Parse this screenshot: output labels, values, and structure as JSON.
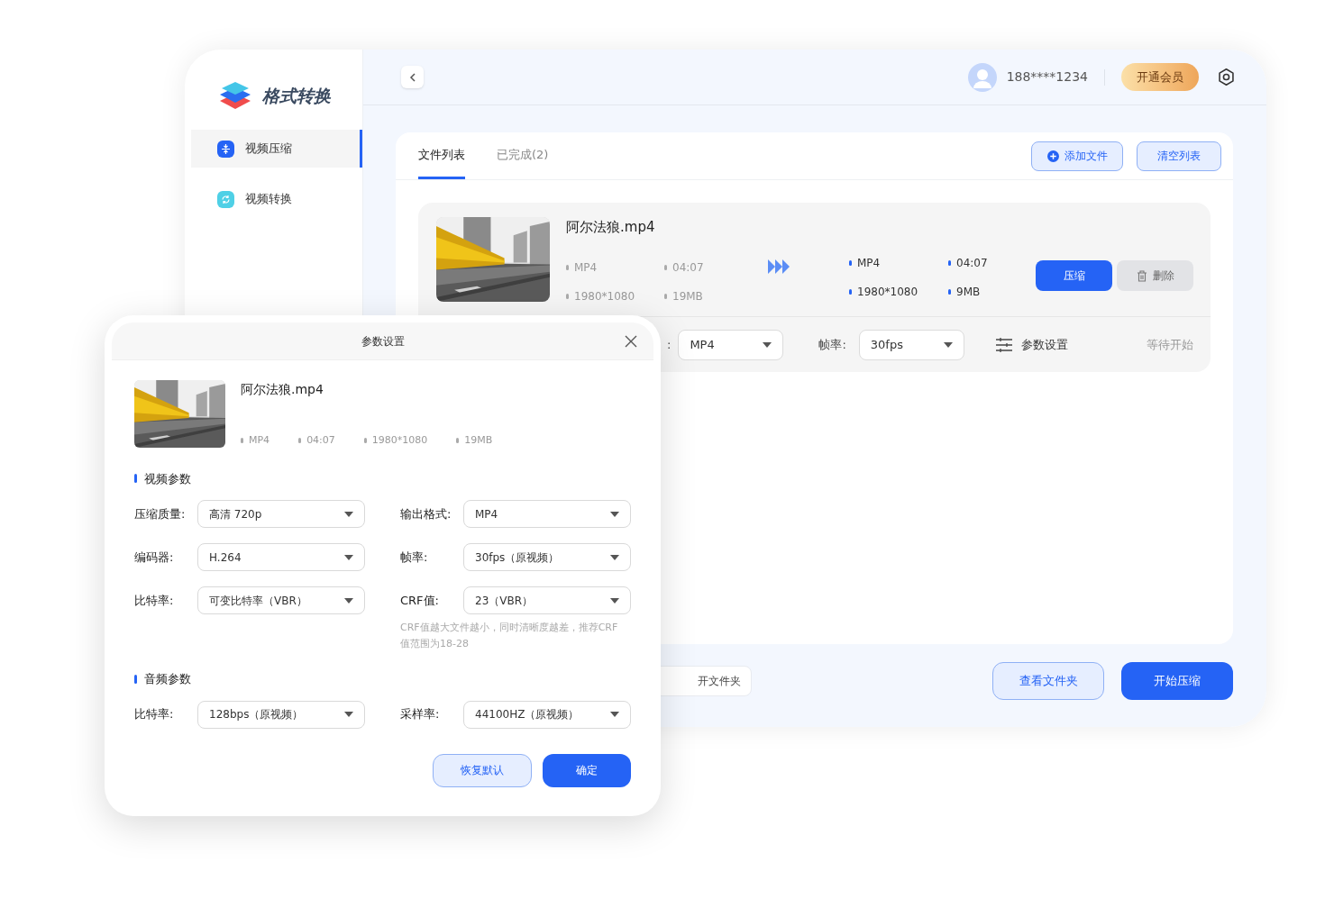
{
  "app": {
    "logo_text": "格式转换"
  },
  "sidebar": {
    "items": [
      {
        "label": "视频压缩",
        "selected": true,
        "kind": "compress"
      },
      {
        "label": "视频转换",
        "selected": false,
        "kind": "convert"
      }
    ]
  },
  "header": {
    "user": "188****1234",
    "vip_button": "开通会员"
  },
  "tabs": [
    {
      "label": "文件列表",
      "selected": true
    },
    {
      "label": "已完成(2)",
      "selected": false
    }
  ],
  "toolbar": {
    "add": "添加文件",
    "clear": "清空列表"
  },
  "file": {
    "name": "阿尔法狼.mp4",
    "source": [
      "MP4",
      "04:07",
      "1980*1080",
      "19MB"
    ],
    "output": [
      "MP4",
      "04:07",
      "1980*1080",
      "9MB"
    ],
    "compress_button": "压缩",
    "delete_button": "删除",
    "settings": [
      {
        "label": ":",
        "value": "MP4"
      },
      {
        "label": "帧率:",
        "value": "30fps"
      }
    ],
    "params_link": "参数设置",
    "status": "等待开始"
  },
  "footer": {
    "open_folder": "开文件夹",
    "view_folder": "查看文件夹",
    "start": "开始压缩"
  },
  "dialog": {
    "title": "参数设置",
    "file": {
      "name": "阿尔法狼.mp4",
      "meta": [
        "MP4",
        "04:07",
        "1980*1080",
        "19MB"
      ]
    },
    "sections": [
      {
        "title": "视频参数",
        "fields": [
          {
            "label": "压缩质量:",
            "value": "高清 720p"
          },
          {
            "label": "输出格式:",
            "value": "MP4"
          },
          {
            "label": "编码器:",
            "value": "H.264"
          },
          {
            "label": "帧率:",
            "value": "30fps（原视频）"
          },
          {
            "label": "比特率:",
            "value": "可变比特率（VBR）"
          },
          {
            "label": "CRF值:",
            "value": "23（VBR）",
            "hint": "CRF值越大文件越小，同时清晰度越差，推荐CRF值范围为18-28"
          }
        ]
      },
      {
        "title": "音频参数",
        "fields": [
          {
            "label": "比特率:",
            "value": "128bps（原视频）"
          },
          {
            "label": "采样率:",
            "value": "44100HZ（原视频）"
          }
        ]
      }
    ],
    "buttons": {
      "reset": "恢复默认",
      "confirm": "确定"
    }
  }
}
